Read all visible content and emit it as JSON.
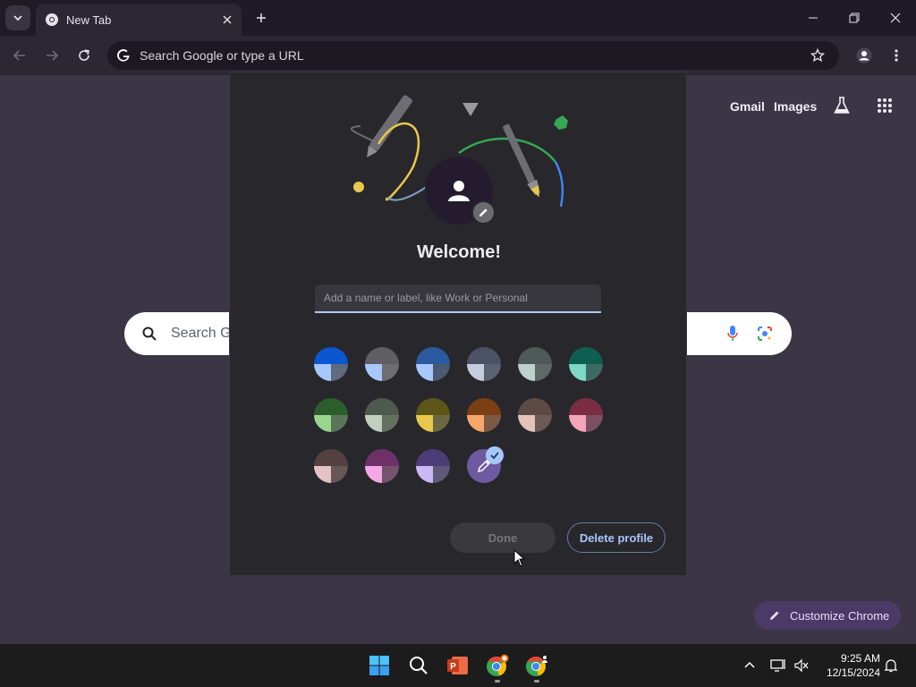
{
  "browser": {
    "tab": {
      "title": "New Tab"
    },
    "omnibox": {
      "placeholder": "Search Google or type a URL"
    }
  },
  "ntp": {
    "links": {
      "gmail": "Gmail",
      "images": "Images"
    },
    "search": {
      "placeholder_visible": "Search Go"
    },
    "customize_label": "Customize Chrome"
  },
  "dialog": {
    "title": "Welcome!",
    "name_input": {
      "placeholder": "Add a name or label, like Work or Personal",
      "value": ""
    },
    "colors": [
      {
        "top": "#0b57d0",
        "left": "#a8c7fa",
        "right": "#5e6a7d"
      },
      {
        "top": "#5f5f63",
        "left": "#a8c7fa",
        "right": "#6e6e72"
      },
      {
        "top": "#2b5aa0",
        "left": "#a8c7fa",
        "right": "#4a5a75"
      },
      {
        "top": "#4a5366",
        "left": "#c4cde0",
        "right": "#5b6272"
      },
      {
        "top": "#4d5a58",
        "left": "#bcd0cc",
        "right": "#5f6866"
      },
      {
        "top": "#0f5e52",
        "left": "#7fd8c4",
        "right": "#3d6b64"
      },
      {
        "top": "#2c5d2c",
        "left": "#98d68f",
        "right": "#5a7558"
      },
      {
        "top": "#4e5a4e",
        "left": "#c2cfbf",
        "right": "#657061"
      },
      {
        "top": "#5e5618",
        "left": "#e8c84c",
        "right": "#6c6740"
      },
      {
        "top": "#7a3f12",
        "left": "#f8a56b",
        "right": "#7a5a44"
      },
      {
        "top": "#5e4a44",
        "left": "#e2c3b7",
        "right": "#6d5a55"
      },
      {
        "top": "#7a2d45",
        "left": "#f6a4b8",
        "right": "#7a5060"
      },
      {
        "top": "#554141",
        "left": "#e2c2c2",
        "right": "#675656"
      },
      {
        "top": "#6d3068",
        "left": "#f4a8e6",
        "right": "#74536f"
      },
      {
        "top": "#4c3d7a",
        "left": "#c9b8f3",
        "right": "#605878"
      }
    ],
    "custom_color": "#6e5aa0",
    "done_label": "Done",
    "delete_label": "Delete profile"
  },
  "taskbar": {
    "time": "9:25 AM",
    "date": "12/15/2024"
  }
}
